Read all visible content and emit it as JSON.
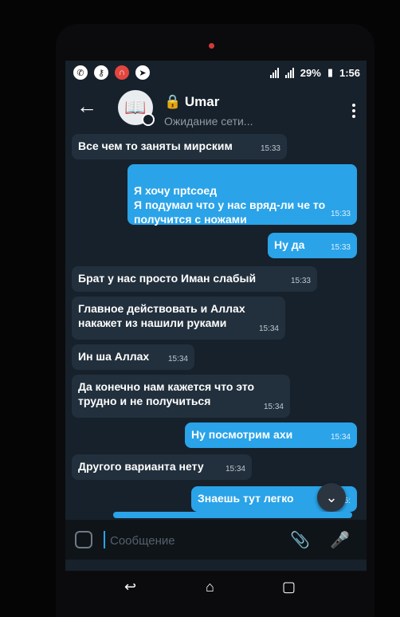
{
  "status": {
    "signal1": "1",
    "signal2": "2",
    "battery": "29%",
    "time": "1:56"
  },
  "header": {
    "back_icon": "back-arrow",
    "contact_name": "Umar",
    "status_text": "Ожидание сети...",
    "menu_icon": "more-vert"
  },
  "messages": [
    {
      "direction": "in",
      "text": "Все чем то заняты мирским",
      "time": "15:33"
    },
    {
      "direction": "out",
      "text": "Я хочу прtсоед\nЯ подумал что у нас вряд-ли че то получится с ножами",
      "time": "15:33"
    },
    {
      "direction": "out",
      "text": "Ну да",
      "time": "15:33"
    },
    {
      "direction": "in",
      "text": "Брат у нас просто Иман слабый",
      "time": "15:33"
    },
    {
      "direction": "in",
      "text": "Главное действовать и Аллах накажет из нашили руками",
      "time": "15:34"
    },
    {
      "direction": "in",
      "text": "Ин ша Аллах",
      "time": "15:34"
    },
    {
      "direction": "in",
      "text": "Да конечно нам кажется что это трудно и не получиться",
      "time": "15:34"
    },
    {
      "direction": "out",
      "text": "Ну посмотрим ахи",
      "time": "15:34"
    },
    {
      "direction": "in",
      "text": "Другого варианта нету",
      "time": "15:34"
    },
    {
      "direction": "out",
      "text": "Знаешь тут легко",
      "time": "15:"
    }
  ],
  "input": {
    "placeholder": "Сообщение"
  },
  "colors": {
    "incoming": "#22303d",
    "outgoing": "#2aa3e8",
    "background": "#17212b"
  }
}
